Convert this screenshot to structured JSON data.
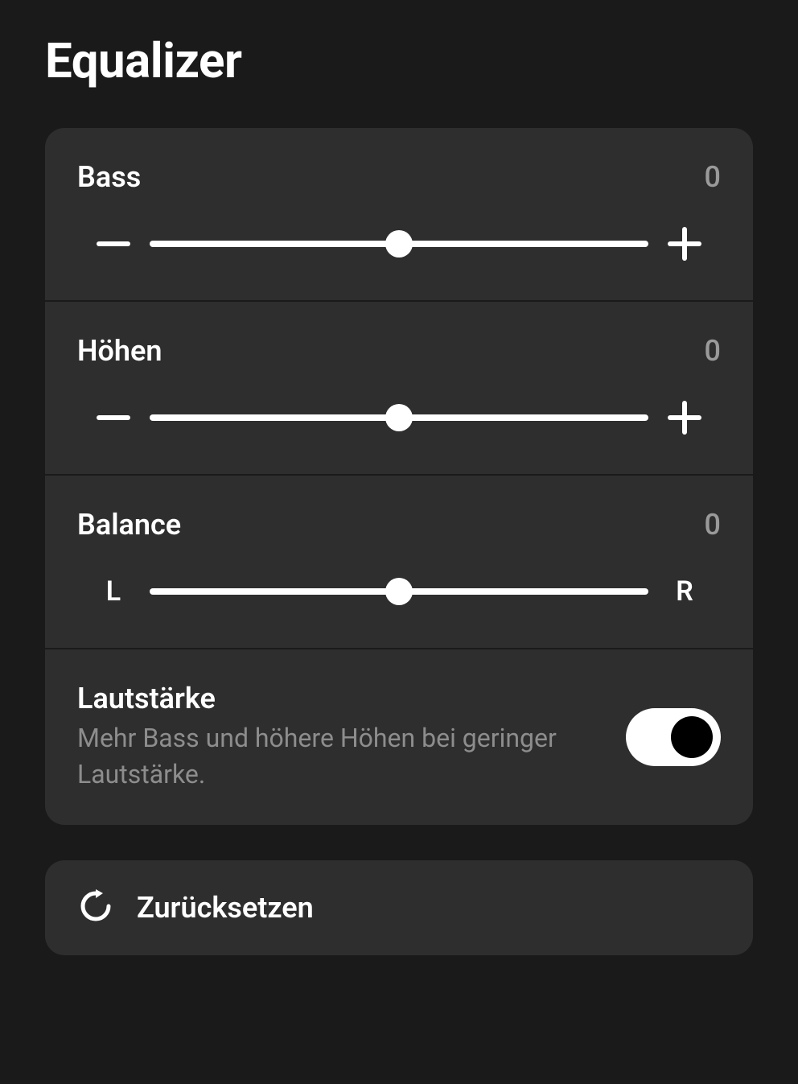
{
  "title": "Equalizer",
  "sliders": {
    "bass": {
      "label": "Bass",
      "value": "0",
      "left": "−",
      "right": "+"
    },
    "treble": {
      "label": "Höhen",
      "value": "0",
      "left": "−",
      "right": "+"
    },
    "balance": {
      "label": "Balance",
      "value": "0",
      "left": "L",
      "right": "R"
    }
  },
  "loudness": {
    "title": "Lautstärke",
    "subtitle": "Mehr Bass und höhere Höhen bei geringer Lautstärke.",
    "enabled": true
  },
  "reset": {
    "label": "Zurücksetzen"
  }
}
